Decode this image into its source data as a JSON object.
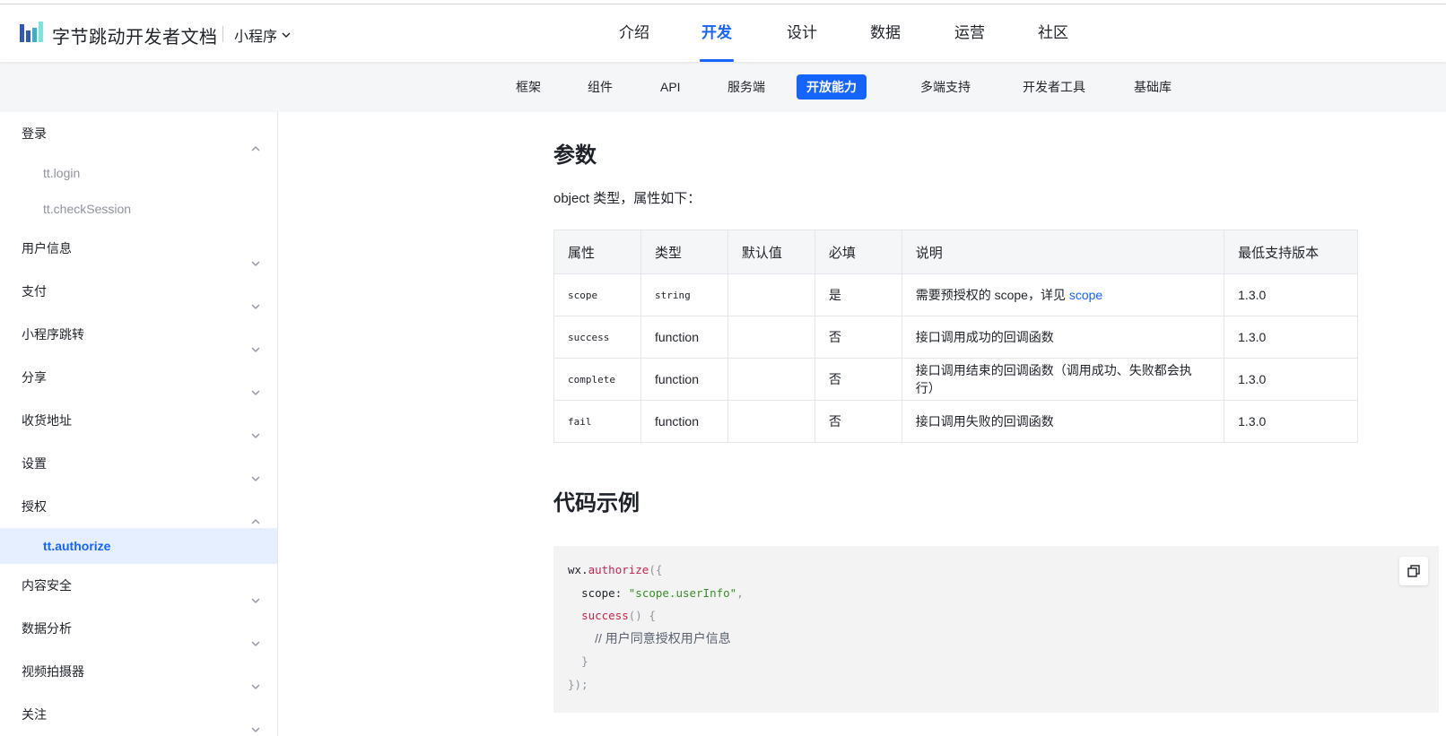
{
  "header": {
    "brand": "字节跳动开发者文档",
    "product": "小程序",
    "nav": [
      {
        "label": "介绍",
        "active": false
      },
      {
        "label": "开发",
        "active": true
      },
      {
        "label": "设计",
        "active": false
      },
      {
        "label": "数据",
        "active": false
      },
      {
        "label": "运营",
        "active": false
      },
      {
        "label": "社区",
        "active": false
      }
    ]
  },
  "subnav": [
    {
      "label": "框架",
      "active": false
    },
    {
      "label": "组件",
      "active": false
    },
    {
      "label": "API",
      "active": false
    },
    {
      "label": "服务端",
      "active": false
    },
    {
      "label": "开放能力",
      "active": true
    },
    {
      "label": "多端支持",
      "active": false
    },
    {
      "label": "开发者工具",
      "active": false
    },
    {
      "label": "基础库",
      "active": false
    }
  ],
  "sidebar": {
    "groups": [
      {
        "label": "登录",
        "expanded": true,
        "children": [
          {
            "label": "tt.login",
            "active": false
          },
          {
            "label": "tt.checkSession",
            "active": false
          }
        ]
      },
      {
        "label": "用户信息",
        "expanded": false,
        "children": []
      },
      {
        "label": "支付",
        "expanded": false,
        "children": []
      },
      {
        "label": "小程序跳转",
        "expanded": false,
        "children": []
      },
      {
        "label": "分享",
        "expanded": false,
        "children": []
      },
      {
        "label": "收货地址",
        "expanded": false,
        "children": []
      },
      {
        "label": "设置",
        "expanded": false,
        "children": []
      },
      {
        "label": "授权",
        "expanded": true,
        "children": [
          {
            "label": "tt.authorize",
            "active": true
          }
        ]
      },
      {
        "label": "内容安全",
        "expanded": false,
        "children": []
      },
      {
        "label": "数据分析",
        "expanded": false,
        "children": []
      },
      {
        "label": "视频拍摄器",
        "expanded": false,
        "children": []
      },
      {
        "label": "关注",
        "expanded": false,
        "children": []
      }
    ]
  },
  "content": {
    "params_title": "参数",
    "params_desc": "object 类型，属性如下：",
    "table": {
      "headers": [
        "属性",
        "类型",
        "默认值",
        "必填",
        "说明",
        "最低支持版本"
      ],
      "rows": [
        {
          "name": "scope",
          "type": "string",
          "type_mono": true,
          "default": "",
          "required": "是",
          "desc": "需要预授权的 scope，详见 ",
          "desc_link": "scope",
          "version": "1.3.0"
        },
        {
          "name": "success",
          "type": "function",
          "type_mono": false,
          "default": "",
          "required": "否",
          "desc": "接口调用成功的回调函数",
          "desc_link": "",
          "version": "1.3.0"
        },
        {
          "name": "complete",
          "type": "function",
          "type_mono": false,
          "default": "",
          "required": "否",
          "desc": "接口调用结束的回调函数（调用成功、失败都会执行）",
          "desc_link": "",
          "version": "1.3.0"
        },
        {
          "name": "fail",
          "type": "function",
          "type_mono": false,
          "default": "",
          "required": "否",
          "desc": "接口调用失败的回调函数",
          "desc_link": "",
          "version": "1.3.0"
        }
      ]
    },
    "code_title": "代码示例",
    "code": {
      "obj": "wx",
      "method": "authorize",
      "scope_key": "scope",
      "scope_value": "\"scope.userInfo\"",
      "success_fn": "success",
      "comment": "// 用户同意授权用户信息"
    }
  },
  "colors": {
    "accent": "#1664ff",
    "code_fn": "#c7254e",
    "code_str": "#3a8d2a"
  }
}
